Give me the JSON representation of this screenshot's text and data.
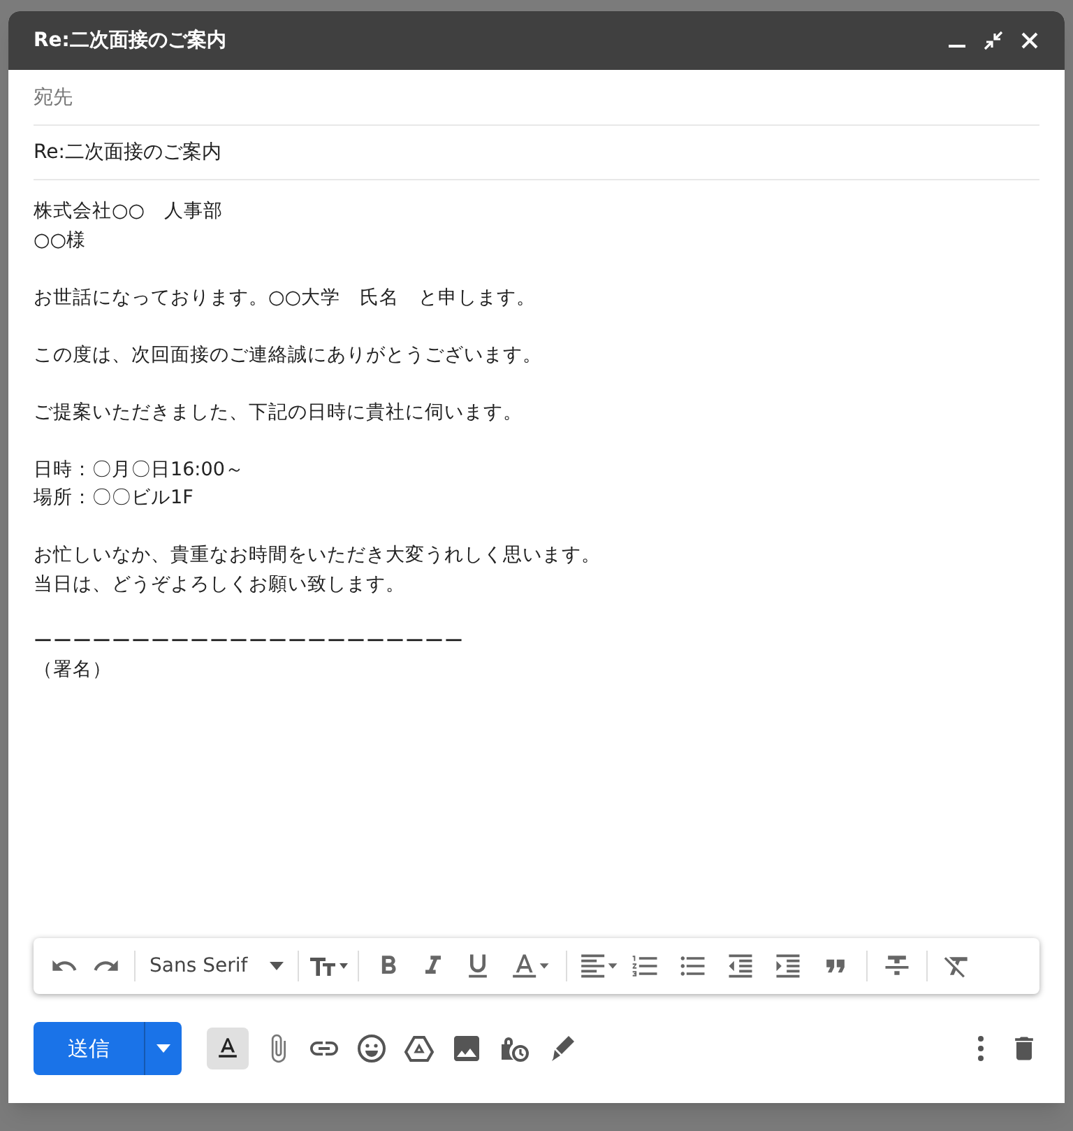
{
  "compose": {
    "title": "Re:二次面接のご案内",
    "to": {
      "placeholder": "宛先"
    },
    "subject": {
      "value": "Re:二次面接のご案内"
    },
    "body": [
      [
        "株式会社○○　人事部",
        "○○様"
      ],
      [
        "お世話になっております。○○大学　氏名　と申します。"
      ],
      [
        "この度は、次回面接のご連絡誠にありがとうございます。"
      ],
      [
        "ご提案いただきました、下記の日時に貴社に伺います。"
      ],
      [
        "日時：〇月〇日16:00～",
        "場所：〇〇ビル1F"
      ],
      [
        "お忙しいなか、貴重なお時間をいただき大変うれしく思います。",
        "当日は、どうぞよろしくお願い致します。"
      ],
      [
        "ーーーーーーーーーーーーーーーーーーーーーー",
        "（署名）"
      ]
    ],
    "font": "Sans Serif",
    "send": "送信",
    "formatting_toggle": {
      "selected": true
    }
  }
}
